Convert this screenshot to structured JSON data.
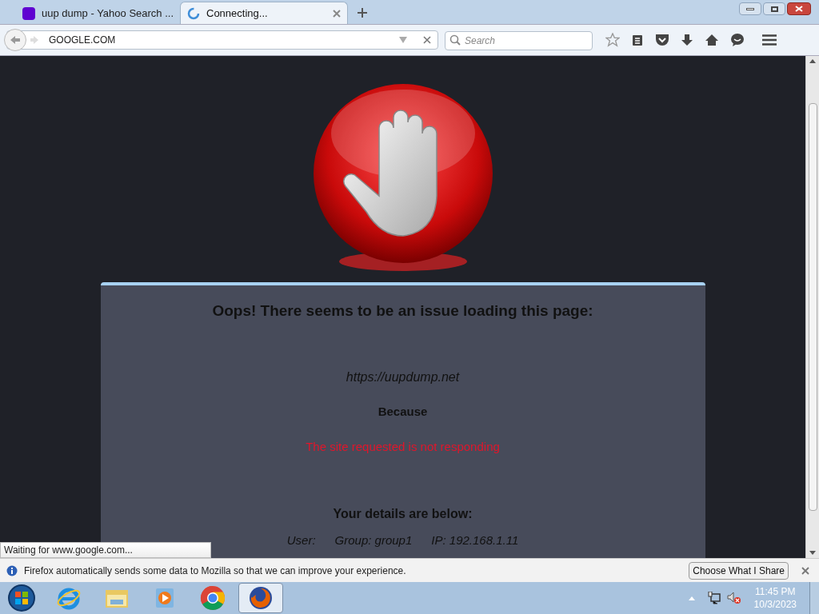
{
  "tabs": [
    {
      "title": "uup dump - Yahoo Search ...",
      "kind": "yahoo",
      "selected": false
    },
    {
      "title": "Connecting...",
      "kind": "loading",
      "selected": true
    }
  ],
  "address_bar": {
    "value": "GOOGLE.COM"
  },
  "search": {
    "placeholder": "Search"
  },
  "page": {
    "heading": "Oops! There seems to be an issue loading this page:",
    "url": "https://uupdump.net",
    "because": "Because",
    "reason": "The site requested is not responding",
    "details_heading": "Your details are below:",
    "details": [
      "User:",
      "Group: group1",
      "IP: 192.168.1.11"
    ]
  },
  "status_text": "Waiting for www.google.com...",
  "notification": {
    "message": "Firefox automatically sends some data to Mozilla so that we can improve your experience.",
    "button": "Choose What I Share"
  },
  "taskbar": {
    "apps": [
      {
        "kind": "ie",
        "selected": false
      },
      {
        "kind": "explorer",
        "selected": false
      },
      {
        "kind": "media",
        "selected": false
      },
      {
        "kind": "chrome",
        "selected": false
      },
      {
        "kind": "firefox",
        "selected": true
      }
    ],
    "time": "11:45 PM",
    "date": "10/3/2023"
  }
}
